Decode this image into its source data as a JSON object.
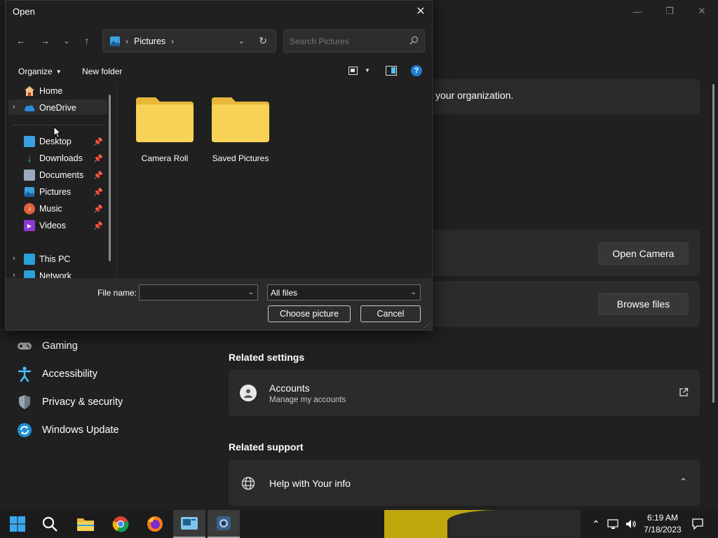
{
  "settings": {
    "org_text": "your organization.",
    "open_camera_label": "Open Camera",
    "browse_files_label": "Browse files",
    "nav": [
      {
        "label": "Gaming"
      },
      {
        "label": "Accessibility"
      },
      {
        "label": "Privacy & security"
      },
      {
        "label": "Windows Update"
      }
    ],
    "related_settings_title": "Related settings",
    "accounts": {
      "title": "Accounts",
      "subtitle": "Manage my accounts"
    },
    "related_support_title": "Related support",
    "help_label": "Help with Your info"
  },
  "dialog": {
    "title": "Open",
    "address_segment": "Pictures",
    "search_placeholder": "Search Pictures",
    "toolbar": {
      "organize": "Organize",
      "new_folder": "New folder"
    },
    "sidebar": [
      {
        "label": "Home",
        "icon": "home-icon"
      },
      {
        "label": "OneDrive",
        "icon": "cloud-icon"
      },
      {
        "label": "Desktop",
        "icon": "desktop-icon",
        "pinned": true
      },
      {
        "label": "Downloads",
        "icon": "download-icon",
        "pinned": true
      },
      {
        "label": "Documents",
        "icon": "document-icon",
        "pinned": true
      },
      {
        "label": "Pictures",
        "icon": "pictures-icon",
        "pinned": true
      },
      {
        "label": "Music",
        "icon": "music-icon",
        "pinned": true
      },
      {
        "label": "Videos",
        "icon": "video-icon",
        "pinned": true
      },
      {
        "label": "This PC",
        "icon": "pc-icon"
      },
      {
        "label": "Network",
        "icon": "network-icon"
      }
    ],
    "folders": [
      {
        "label": "Camera Roll"
      },
      {
        "label": "Saved Pictures"
      }
    ],
    "file_name_label": "File name:",
    "file_name_value": "",
    "filter_value": "All files",
    "choose_label": "Choose picture",
    "cancel_label": "Cancel"
  },
  "taskbar": {
    "time": "6:19 AM",
    "date": "7/18/2023"
  },
  "colors": {
    "folder_yellow": "#f8d256",
    "accent_blue": "#4cc2ff",
    "taskbar": "#1c1c1c"
  }
}
